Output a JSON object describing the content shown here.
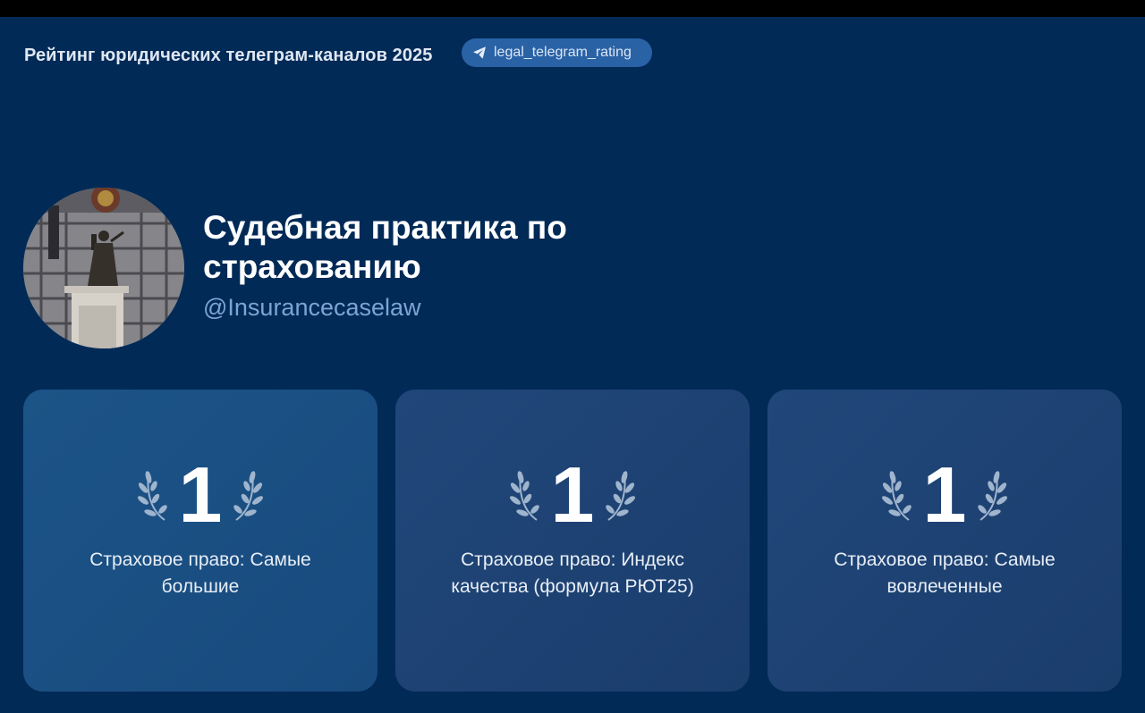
{
  "header": {
    "title": "Рейтинг юридических телеграм-каналов 2025",
    "badge_label": "legal_telegram_rating",
    "badge_icon": "telegram-send-icon"
  },
  "channel": {
    "title": "Судебная практика по страхованию",
    "handle": "@Insurancecaselaw"
  },
  "cards": [
    {
      "rank": "1",
      "label": "Страховое право: Самые большие"
    },
    {
      "rank": "1",
      "label": "Страховое право: Индекс качества (формула РЮТ25)"
    },
    {
      "rank": "1",
      "label": "Страховое право: Самые вовлеченные"
    }
  ],
  "colors": {
    "background": "#022a57",
    "badge": "#2a62a6",
    "card_primary": "#1c5487",
    "card_secondary": "#21477a",
    "handle": "#7ea4d4"
  }
}
